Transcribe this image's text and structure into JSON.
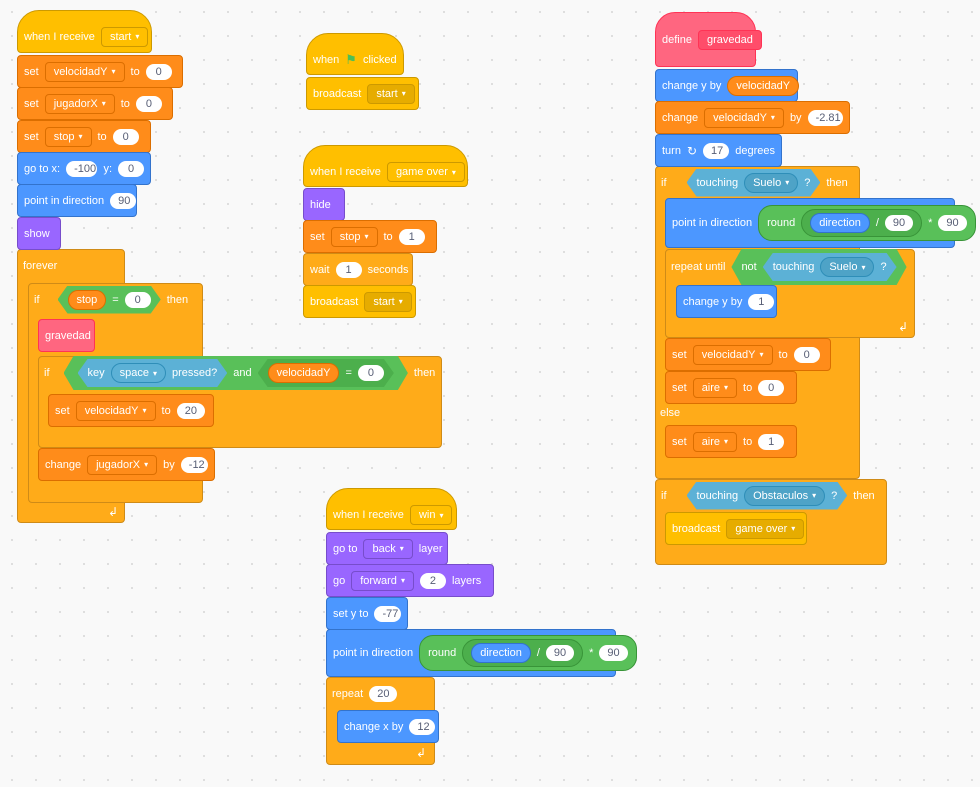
{
  "script1": {
    "hat": {
      "text": "when I receive",
      "msg": "start"
    },
    "set1": {
      "text": "set",
      "var": "velocidadY",
      "to": "to",
      "val": "0"
    },
    "set2": {
      "text": "set",
      "var": "jugadorX",
      "to": "to",
      "val": "0"
    },
    "set3": {
      "text": "set",
      "var": "stop",
      "to": "to",
      "val": "0"
    },
    "goto": {
      "text": "go to x:",
      "x": "-100",
      "ylabel": "y:",
      "y": "0"
    },
    "point": {
      "text": "point in direction",
      "val": "90"
    },
    "show": "show",
    "forever": "forever",
    "if1": {
      "if": "if",
      "var": "stop",
      "eq": "=",
      "val": "0",
      "then": "then"
    },
    "gravedad": "gravedad",
    "if2": {
      "if": "if",
      "key": "key",
      "keyname": "space",
      "pressed": "pressed?",
      "and": "and",
      "var": "velocidadY",
      "eq": "=",
      "val": "0",
      "then": "then"
    },
    "set4": {
      "text": "set",
      "var": "velocidadY",
      "to": "to",
      "val": "20"
    },
    "change": {
      "text": "change",
      "var": "jugadorX",
      "by": "by",
      "val": "-12"
    }
  },
  "script2": {
    "hat": {
      "text": "when",
      "flag": "⚑",
      "clicked": "clicked"
    },
    "broadcast": {
      "text": "broadcast",
      "msg": "start"
    }
  },
  "script3": {
    "hat": {
      "text": "when I receive",
      "msg": "game over"
    },
    "hide": "hide",
    "set": {
      "text": "set",
      "var": "stop",
      "to": "to",
      "val": "1"
    },
    "wait": {
      "text": "wait",
      "val": "1",
      "unit": "seconds"
    },
    "broadcast": {
      "text": "broadcast",
      "msg": "start"
    }
  },
  "script4": {
    "hat": {
      "text": "when I receive",
      "msg": "win"
    },
    "goto": {
      "text": "go to",
      "layer": "back",
      "suffix": "layer"
    },
    "go": {
      "text": "go",
      "dir": "forward",
      "val": "2",
      "suffix": "layers"
    },
    "sety": {
      "text": "set y to",
      "val": "-77"
    },
    "point": {
      "text": "point in direction",
      "round": "round",
      "dir": "direction",
      "div": "/",
      "a": "90",
      "mul": "*",
      "b": "90"
    },
    "repeat": {
      "text": "repeat",
      "val": "20"
    },
    "changex": {
      "text": "change x by",
      "val": "12"
    }
  },
  "script5": {
    "define": {
      "text": "define",
      "name": "gravedad"
    },
    "changey": {
      "text": "change y by",
      "var": "velocidadY"
    },
    "change": {
      "text": "change",
      "var": "velocidadY",
      "by": "by",
      "val": "-2.81"
    },
    "turn": {
      "text": "turn",
      "val": "17",
      "unit": "degrees"
    },
    "if": {
      "if": "if",
      "touching": "touching",
      "obj": "Suelo",
      "q": "?",
      "then": "then"
    },
    "point": {
      "text": "point in direction",
      "round": "round",
      "dir": "direction",
      "div": "/",
      "a": "90",
      "mul": "*",
      "b": "90"
    },
    "repeat": {
      "text": "repeat until",
      "not": "not",
      "touching": "touching",
      "obj": "Suelo",
      "q": "?"
    },
    "changey2": {
      "text": "change y by",
      "val": "1"
    },
    "set1": {
      "text": "set",
      "var": "velocidadY",
      "to": "to",
      "val": "0"
    },
    "set2": {
      "text": "set",
      "var": "aire",
      "to": "to",
      "val": "0"
    },
    "else": "else",
    "set3": {
      "text": "set",
      "var": "aire",
      "to": "to",
      "val": "1"
    },
    "if2": {
      "if": "if",
      "touching": "touching",
      "obj": "Obstaculos",
      "q": "?",
      "then": "then"
    },
    "broadcast": {
      "text": "broadcast",
      "msg": "game over"
    }
  },
  "icons": {
    "dropdown": "▾",
    "turn": "↻",
    "loop": "↲"
  }
}
